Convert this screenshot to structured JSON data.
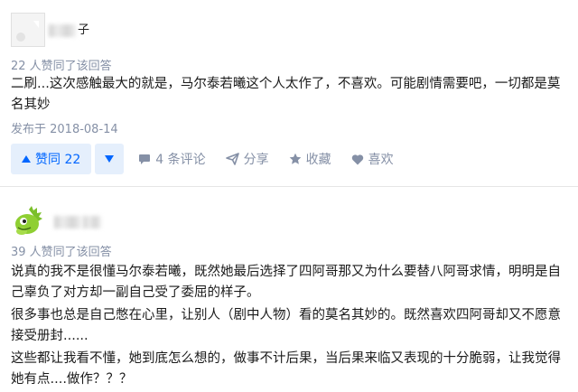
{
  "answer1": {
    "username_visible": "子",
    "votes_text": "22 人赞同了该回答",
    "paragraphs": [
      "二刷...这次感触最大的就是，马尔泰若曦这个人太作了，不喜欢。可能剧情需要吧，一切都是莫名其妙"
    ],
    "date": "发布于 2018-08-14",
    "actions": {
      "upvote_label": "赞同 22",
      "comments_label": "4 条评论",
      "share_label": "分享",
      "collect_label": "收藏",
      "like_label": "喜欢"
    }
  },
  "answer2": {
    "votes_text": "39 人赞同了该回答",
    "paragraphs": [
      "说真的我不是很懂马尔泰若曦，既然她最后选择了四阿哥那又为什么要替八阿哥求情，明明是自己辜负了对方却一副自己受了委屈的样子。",
      "很多事也总是自己憋在心里，让别人（剧中人物）看的莫名其妙的。既然喜欢四阿哥却又不愿意接受册封......",
      "这些都让我看不懂，她到底怎么想的，做事不计后果，当后果来临又表现的十分脆弱，让我觉得她有点....做作？？？"
    ]
  },
  "colors": {
    "accent": "#0066ff",
    "accent_bg": "#e5effc",
    "meta": "#8590a6"
  }
}
